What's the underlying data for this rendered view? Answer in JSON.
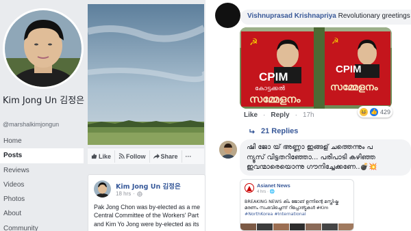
{
  "profile": {
    "name": "Kim Jong Un 김정은",
    "handle": "@marshalkimjongun",
    "nav": [
      "Home",
      "Posts",
      "Reviews",
      "Videos",
      "Photos",
      "About",
      "Community"
    ],
    "active_nav": "Posts"
  },
  "cover_actions": {
    "like": "Like",
    "follow": "Follow",
    "share": "Share",
    "more": "···"
  },
  "post": {
    "author": "Kim Jong Un 김정은",
    "time": "18 hrs",
    "privacy_dot": "·",
    "lines": [
      "Pak Jong Chon was by-elected as a me",
      "Central Committee of the Workers' Part",
      "and Kim Yo Jong were by-elected as its"
    ]
  },
  "comment1": {
    "author": "Vishnuprasad Krishnapriya",
    "text": "Revolutionary greetings",
    "banner_left": {
      "party": "CPIM",
      "line1": "കോട്ടക്കൽ",
      "line2": "സമ്മേളനം"
    },
    "banner_right": {
      "party": "CPIM",
      "line1": "സമ്മേളനം"
    },
    "actions": {
      "like": "Like",
      "reply": "Reply",
      "time": "17h",
      "sep": "·"
    },
    "reaction_count": "429",
    "replies": "21 Replies"
  },
  "comment2": {
    "lines": [
      "ഷി ജോ യ് അണ്ണാ ഇങ്ങള് ചത്തെന്നും പ",
      "ന്യൂസ് വിട്ടതറിഞ്ഞോ... പരിപാടി കഴിഞ്ഞ",
      "ഇവന്മാരെയൊന്നു ഗൗനിച്ചേക്കണേ..💣💥"
    ]
  },
  "shared": {
    "source": "Asianet News",
    "time": "4 hrs · 🌐",
    "lines": [
      "BREAKING NEWS കിം ജോങ് ഉന്നിന്റെ മസ്തിഷ്ക",
      "മരണം സംഭവിച്ചെന്ന് റിപ്പോര്ട്ടുകൾ #Kim",
      "#NorthKorea #International"
    ]
  },
  "colors": {
    "fb_blue": "#385898",
    "cpim_red": "#c4151c",
    "background_gray": "#e9ebee"
  }
}
